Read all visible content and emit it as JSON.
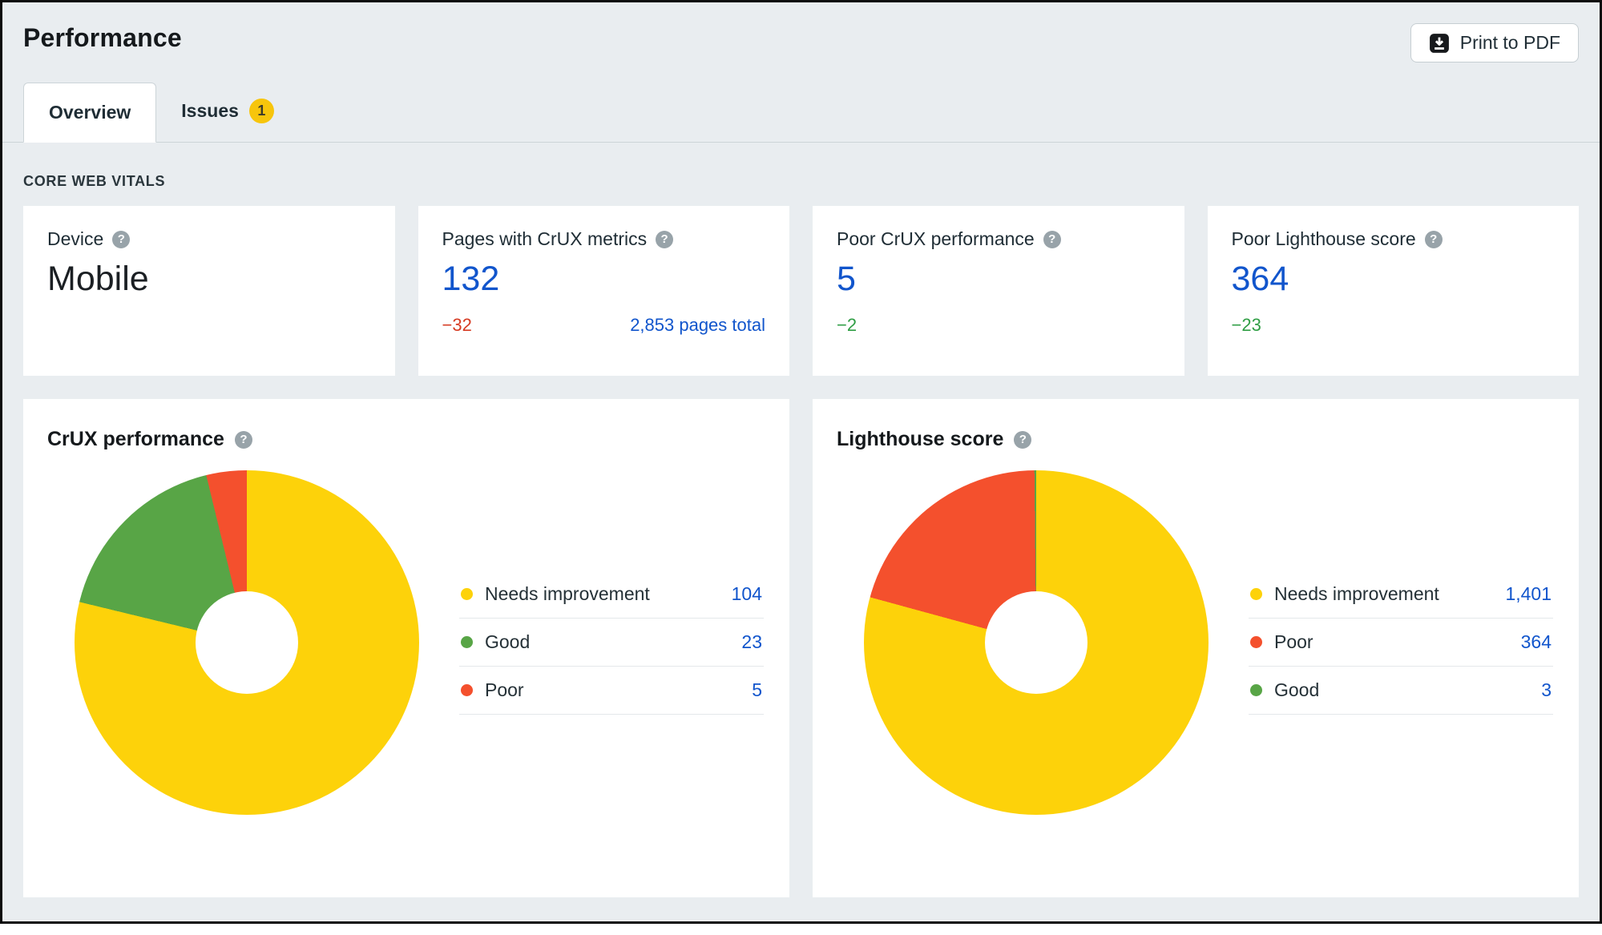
{
  "header": {
    "title": "Performance",
    "print_button_label": "Print to PDF"
  },
  "tabs": {
    "overview_label": "Overview",
    "issues_label": "Issues",
    "issues_badge": "1"
  },
  "section_label": "CORE WEB VITALS",
  "stat_cards": [
    {
      "label": "Device",
      "value": "Mobile"
    },
    {
      "label": "Pages with CrUX metrics",
      "value": "132",
      "delta": "−32",
      "extra": "2,853 pages total"
    },
    {
      "label": "Poor CrUX performance",
      "value": "5",
      "delta": "−2"
    },
    {
      "label": "Poor Lighthouse score",
      "value": "364",
      "delta": "−23"
    }
  ],
  "chart_data": [
    {
      "type": "pie",
      "donut": true,
      "title": "CrUX performance",
      "labels": [
        "Needs improvement",
        "Good",
        "Poor"
      ],
      "values": [
        104,
        23,
        5
      ],
      "display_values": [
        "104",
        "23",
        "5"
      ],
      "colors": [
        "#fdd20a",
        "#58a546",
        "#f4502d"
      ],
      "legend_position": "right"
    },
    {
      "type": "pie",
      "donut": true,
      "title": "Lighthouse score",
      "labels": [
        "Needs improvement",
        "Poor",
        "Good"
      ],
      "values": [
        1401,
        364,
        3
      ],
      "display_values": [
        "1,401",
        "364",
        "3"
      ],
      "colors": [
        "#fdd20a",
        "#f4502d",
        "#58a546"
      ],
      "legend_position": "right"
    }
  ],
  "colors": {
    "accent_blue": "#1155cc",
    "negative_red": "#d63b23",
    "positive_green": "#2f9e44",
    "chart_yellow": "#fdd20a",
    "chart_green": "#58a546",
    "chart_red": "#f4502d",
    "badge_yellow": "#f7c50c",
    "page_background": "#e9edf0"
  }
}
